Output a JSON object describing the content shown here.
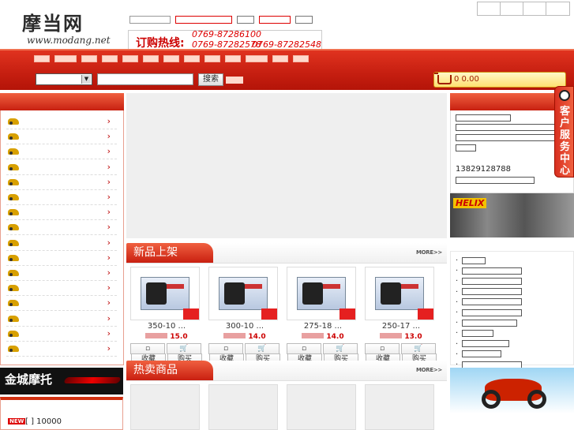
{
  "top_links": [
    "",
    "",
    "",
    ""
  ],
  "logo": {
    "cn": "摩当网",
    "en": "www.modang.net"
  },
  "header_info": {
    "parts": [
      "",
      "",
      "",
      "",
      "",
      ""
    ]
  },
  "hotline": {
    "label": "订购热线:",
    "phones": [
      "0769-87286100",
      "0769-87282578",
      "0769-87282548"
    ]
  },
  "nav_items": [
    "",
    "",
    "",
    "",
    "",
    "",
    "",
    "",
    "",
    "",
    "",
    "",
    ""
  ],
  "search": {
    "category": "",
    "placeholder": "",
    "button": "搜索",
    "advanced": ""
  },
  "cart": {
    "text": "  0         0.00"
  },
  "left_categories": [
    {
      "label": ""
    },
    {
      "label": ""
    },
    {
      "label": ""
    },
    {
      "label": ""
    },
    {
      "label": ""
    },
    {
      "label": ""
    },
    {
      "label": ""
    },
    {
      "label": ""
    },
    {
      "label": ""
    },
    {
      "label": ""
    },
    {
      "label": ""
    },
    {
      "label": ""
    },
    {
      "label": ""
    },
    {
      "label": ""
    },
    {
      "label": ""
    },
    {
      "label": ""
    }
  ],
  "left_banner": {
    "text": "金城摩托"
  },
  "news": {
    "badge": "NEW",
    "text": "[  ]              10000"
  },
  "new_products": {
    "title": "新品上架",
    "more": "MORE>>",
    "items": [
      {
        "name": "350-10 ...",
        "price": "15.0",
        "collect": "收藏",
        "buy": "购买"
      },
      {
        "name": "300-10 ...",
        "price": "14.0",
        "collect": "收藏",
        "buy": "购买"
      },
      {
        "name": "275-18 ...",
        "price": "14.0",
        "collect": "收藏",
        "buy": "购买"
      },
      {
        "name": "250-17 ...",
        "price": "13.0",
        "collect": "收藏",
        "buy": "购买"
      }
    ]
  },
  "hot_products": {
    "title": "热卖商品",
    "more": "MORE>>"
  },
  "right_info": {
    "tel": "   13829128788",
    "blocks": [
      "",
      "",
      "",
      "",
      ""
    ]
  },
  "right_banner": {
    "logo": "HELIX"
  },
  "right_list": [
    "",
    "",
    "",
    "",
    "",
    "",
    "",
    "",
    "",
    "",
    ""
  ],
  "service": {
    "text": "客户服务中心"
  },
  "colors": {
    "brand_red": "#d22a18",
    "price_red": "#cc0000"
  }
}
